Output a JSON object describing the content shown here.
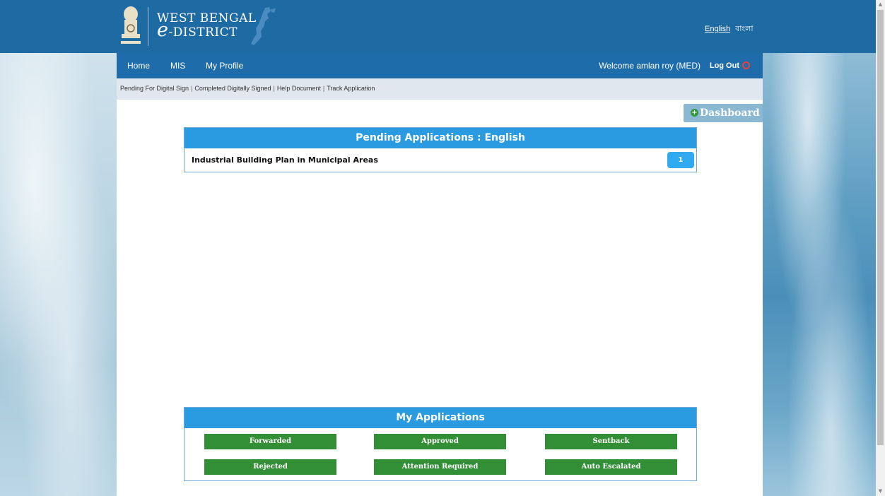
{
  "header": {
    "brand_line1": "WEST BENGAL",
    "brand_e": "e",
    "brand_line2": "-DISTRICT",
    "lang_english": "English",
    "lang_bangla": "বাংলা"
  },
  "nav": {
    "items": [
      "Home",
      "MIS",
      "My Profile"
    ],
    "welcome": "Welcome amlan roy (MED)",
    "logout": "Log Out"
  },
  "subnav": {
    "links": [
      "Pending For Digital Sign",
      "Completed Digitally Signed",
      "Help Document",
      "Track Application"
    ]
  },
  "dashboard": {
    "label": "Dashboard"
  },
  "pending": {
    "title": "Pending Applications : English",
    "rows": [
      {
        "label": "Industrial Building Plan in Municipal Areas",
        "count": "1"
      }
    ]
  },
  "my_apps": {
    "title": "My Applications",
    "buttons": [
      "Forwarded",
      "Approved",
      "Sentback",
      "Rejected",
      "Attention Required",
      "Auto Escalated"
    ]
  },
  "colors": {
    "header_bg": "#1e6aa3",
    "panel_head": "#2a9be0",
    "button_green": "#338f36",
    "count_badge": "#2fa9f0"
  }
}
